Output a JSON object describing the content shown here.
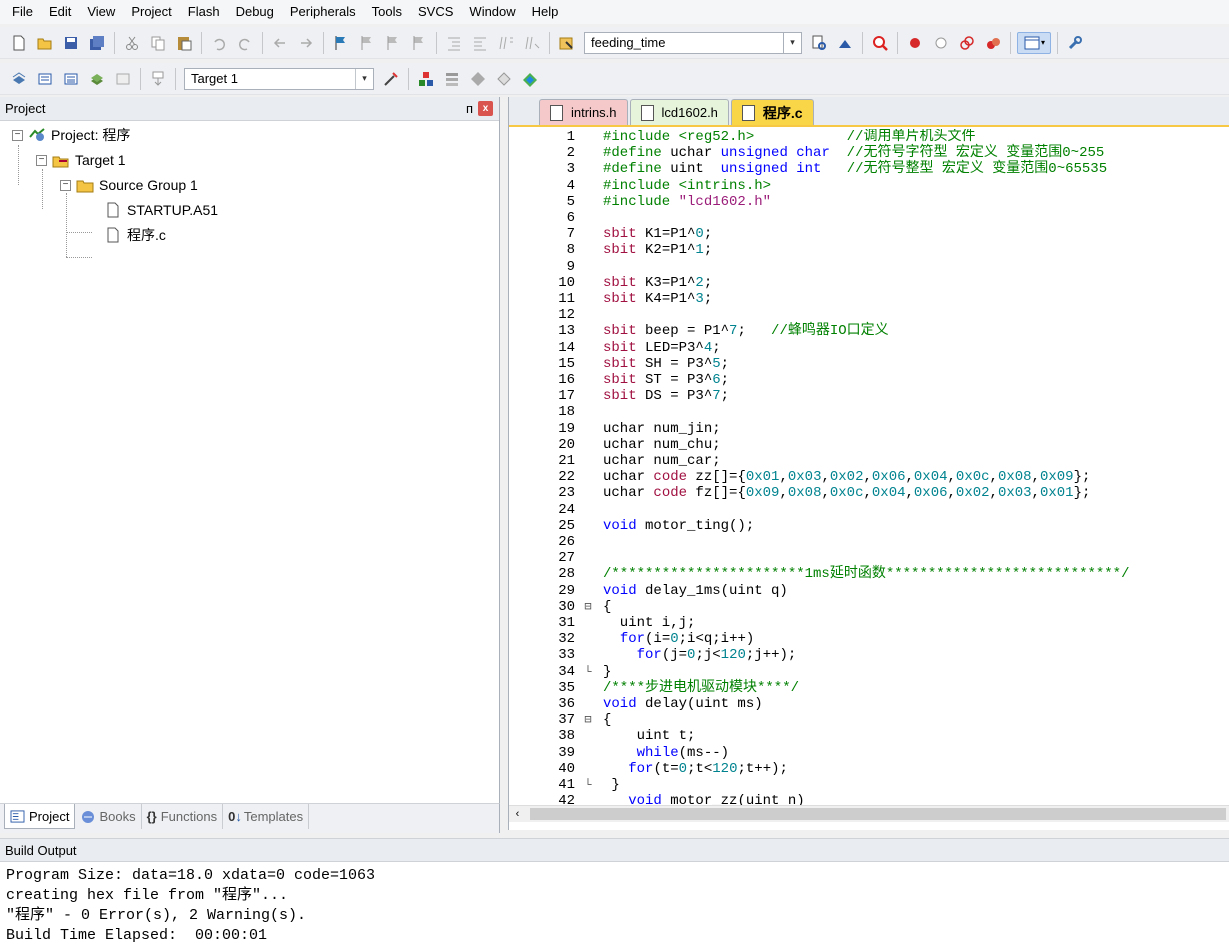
{
  "menu": [
    "File",
    "Edit",
    "View",
    "Project",
    "Flash",
    "Debug",
    "Peripherals",
    "Tools",
    "SVCS",
    "Window",
    "Help"
  ],
  "toolbar1": {
    "find_combo_value": "feeding_time"
  },
  "toolbar2": {
    "target_combo_value": "Target 1"
  },
  "project_panel": {
    "title": "Project",
    "pin_glyph": "ᴨ",
    "close_glyph": "x",
    "tree": [
      {
        "label": "Project: 程序",
        "icon": "project-icon",
        "toggle": "−"
      },
      {
        "label": "Target 1",
        "icon": "target-icon",
        "toggle": "−"
      },
      {
        "label": "Source Group 1",
        "icon": "folder-icon",
        "toggle": "−"
      },
      {
        "label": "STARTUP.A51",
        "icon": "file-icon"
      },
      {
        "label": "程序.c",
        "icon": "file-icon"
      }
    ],
    "tabs": [
      "Project",
      "Books",
      "Functions",
      "Templates"
    ]
  },
  "editor": {
    "tabs": [
      {
        "label": "intrins.h"
      },
      {
        "label": "lcd1602.h"
      },
      {
        "label": "程序.c",
        "active": true
      }
    ],
    "lines": [
      {
        "n": "1",
        "f": "",
        "segs": [
          [
            "pp",
            "#include <reg52.h>"
          ],
          [
            "t",
            "           "
          ],
          [
            "cm",
            "//调用单片机头文件"
          ]
        ]
      },
      {
        "n": "2",
        "f": "",
        "segs": [
          [
            "pp",
            "#define "
          ],
          [
            "t",
            "uchar "
          ],
          [
            "kw",
            "unsigned char"
          ],
          [
            "t",
            "  "
          ],
          [
            "cm",
            "//无符号字符型 宏定义 变量范围0~255"
          ]
        ]
      },
      {
        "n": "3",
        "f": "",
        "segs": [
          [
            "pp",
            "#define "
          ],
          [
            "t",
            "uint  "
          ],
          [
            "kw",
            "unsigned int"
          ],
          [
            "t",
            "   "
          ],
          [
            "cm",
            "//无符号整型 宏定义 变量范围0~65535"
          ]
        ]
      },
      {
        "n": "4",
        "f": "",
        "segs": [
          [
            "pp",
            "#include <intrins.h>"
          ]
        ]
      },
      {
        "n": "5",
        "f": "",
        "segs": [
          [
            "pp",
            "#include "
          ],
          [
            "str",
            "\"lcd1602.h\""
          ]
        ]
      },
      {
        "n": "6",
        "f": "",
        "segs": []
      },
      {
        "n": "7",
        "f": "",
        "segs": [
          [
            "ty",
            "sbit"
          ],
          [
            "t",
            " K1=P1^"
          ],
          [
            "num",
            "0"
          ],
          [
            "t",
            ";"
          ]
        ]
      },
      {
        "n": "8",
        "f": "",
        "segs": [
          [
            "ty",
            "sbit"
          ],
          [
            "t",
            " K2=P1^"
          ],
          [
            "num",
            "1"
          ],
          [
            "t",
            ";"
          ]
        ]
      },
      {
        "n": "9",
        "f": "",
        "segs": []
      },
      {
        "n": "10",
        "f": "",
        "segs": [
          [
            "ty",
            "sbit"
          ],
          [
            "t",
            " K3=P1^"
          ],
          [
            "num",
            "2"
          ],
          [
            "t",
            ";"
          ]
        ]
      },
      {
        "n": "11",
        "f": "",
        "segs": [
          [
            "ty",
            "sbit"
          ],
          [
            "t",
            " K4=P1^"
          ],
          [
            "num",
            "3"
          ],
          [
            "t",
            ";"
          ]
        ]
      },
      {
        "n": "12",
        "f": "",
        "segs": []
      },
      {
        "n": "13",
        "f": "",
        "segs": [
          [
            "ty",
            "sbit"
          ],
          [
            "t",
            " beep = P1^"
          ],
          [
            "num",
            "7"
          ],
          [
            "t",
            ";   "
          ],
          [
            "cm",
            "//蜂鸣器IO口定义"
          ]
        ]
      },
      {
        "n": "14",
        "f": "",
        "segs": [
          [
            "ty",
            "sbit"
          ],
          [
            "t",
            " LED=P3^"
          ],
          [
            "num",
            "4"
          ],
          [
            "t",
            ";"
          ]
        ]
      },
      {
        "n": "15",
        "f": "",
        "segs": [
          [
            "ty",
            "sbit"
          ],
          [
            "t",
            " SH = P3^"
          ],
          [
            "num",
            "5"
          ],
          [
            "t",
            ";"
          ]
        ]
      },
      {
        "n": "16",
        "f": "",
        "segs": [
          [
            "ty",
            "sbit"
          ],
          [
            "t",
            " ST = P3^"
          ],
          [
            "num",
            "6"
          ],
          [
            "t",
            ";"
          ]
        ]
      },
      {
        "n": "17",
        "f": "",
        "segs": [
          [
            "ty",
            "sbit"
          ],
          [
            "t",
            " DS = P3^"
          ],
          [
            "num",
            "7"
          ],
          [
            "t",
            ";"
          ]
        ]
      },
      {
        "n": "18",
        "f": "",
        "segs": []
      },
      {
        "n": "19",
        "f": "",
        "segs": [
          [
            "t",
            "uchar num_jin;"
          ]
        ]
      },
      {
        "n": "20",
        "f": "",
        "segs": [
          [
            "t",
            "uchar num_chu;"
          ]
        ]
      },
      {
        "n": "21",
        "f": "",
        "segs": [
          [
            "t",
            "uchar num_car;"
          ]
        ]
      },
      {
        "n": "22",
        "f": "",
        "segs": [
          [
            "t",
            "uchar "
          ],
          [
            "ty",
            "code"
          ],
          [
            "t",
            " zz[]={"
          ],
          [
            "num",
            "0x01"
          ],
          [
            "t",
            ","
          ],
          [
            "num",
            "0x03"
          ],
          [
            "t",
            ","
          ],
          [
            "num",
            "0x02"
          ],
          [
            "t",
            ","
          ],
          [
            "num",
            "0x06"
          ],
          [
            "t",
            ","
          ],
          [
            "num",
            "0x04"
          ],
          [
            "t",
            ","
          ],
          [
            "num",
            "0x0c"
          ],
          [
            "t",
            ","
          ],
          [
            "num",
            "0x08"
          ],
          [
            "t",
            ","
          ],
          [
            "num",
            "0x09"
          ],
          [
            "t",
            "};"
          ]
        ]
      },
      {
        "n": "23",
        "f": "",
        "segs": [
          [
            "t",
            "uchar "
          ],
          [
            "ty",
            "code"
          ],
          [
            "t",
            " fz[]={"
          ],
          [
            "num",
            "0x09"
          ],
          [
            "t",
            ","
          ],
          [
            "num",
            "0x08"
          ],
          [
            "t",
            ","
          ],
          [
            "num",
            "0x0c"
          ],
          [
            "t",
            ","
          ],
          [
            "num",
            "0x04"
          ],
          [
            "t",
            ","
          ],
          [
            "num",
            "0x06"
          ],
          [
            "t",
            ","
          ],
          [
            "num",
            "0x02"
          ],
          [
            "t",
            ","
          ],
          [
            "num",
            "0x03"
          ],
          [
            "t",
            ","
          ],
          [
            "num",
            "0x01"
          ],
          [
            "t",
            "};"
          ]
        ]
      },
      {
        "n": "24",
        "f": "",
        "segs": []
      },
      {
        "n": "25",
        "f": "",
        "segs": [
          [
            "kw",
            "void"
          ],
          [
            "t",
            " motor_ting();"
          ]
        ]
      },
      {
        "n": "26",
        "f": "",
        "segs": []
      },
      {
        "n": "27",
        "f": "",
        "segs": []
      },
      {
        "n": "28",
        "f": "",
        "segs": [
          [
            "cm",
            "/***********************1ms延时函数****************************/"
          ]
        ]
      },
      {
        "n": "29",
        "f": "",
        "segs": [
          [
            "kw",
            "void"
          ],
          [
            "t",
            " delay_1ms(uint q)"
          ]
        ]
      },
      {
        "n": "30",
        "f": "⊟",
        "segs": [
          [
            "t",
            "{"
          ]
        ]
      },
      {
        "n": "31",
        "f": "",
        "segs": [
          [
            "t",
            "  uint i,j;"
          ]
        ]
      },
      {
        "n": "32",
        "f": "",
        "segs": [
          [
            "t",
            "  "
          ],
          [
            "kw",
            "for"
          ],
          [
            "t",
            "(i="
          ],
          [
            "num",
            "0"
          ],
          [
            "t",
            ";i<q;i++)"
          ]
        ]
      },
      {
        "n": "33",
        "f": "",
        "segs": [
          [
            "t",
            "    "
          ],
          [
            "kw",
            "for"
          ],
          [
            "t",
            "(j="
          ],
          [
            "num",
            "0"
          ],
          [
            "t",
            ";j<"
          ],
          [
            "num",
            "120"
          ],
          [
            "t",
            ";j++);"
          ]
        ]
      },
      {
        "n": "34",
        "f": "└",
        "segs": [
          [
            "t",
            "}"
          ]
        ]
      },
      {
        "n": "35",
        "f": "",
        "segs": [
          [
            "cm",
            "/****步进电机驱动模块****/"
          ]
        ]
      },
      {
        "n": "36",
        "f": "",
        "segs": [
          [
            "kw",
            "void"
          ],
          [
            "t",
            " delay(uint ms)"
          ]
        ]
      },
      {
        "n": "37",
        "f": "⊟",
        "segs": [
          [
            "t",
            "{"
          ]
        ]
      },
      {
        "n": "38",
        "f": "",
        "segs": [
          [
            "t",
            "    uint t;"
          ]
        ]
      },
      {
        "n": "39",
        "f": "",
        "segs": [
          [
            "t",
            "    "
          ],
          [
            "kw",
            "while"
          ],
          [
            "t",
            "(ms--)"
          ]
        ]
      },
      {
        "n": "40",
        "f": "",
        "segs": [
          [
            "t",
            "   "
          ],
          [
            "kw",
            "for"
          ],
          [
            "t",
            "(t="
          ],
          [
            "num",
            "0"
          ],
          [
            "t",
            ";t<"
          ],
          [
            "num",
            "120"
          ],
          [
            "t",
            ";t++);"
          ]
        ]
      },
      {
        "n": "41",
        "f": "└",
        "segs": [
          [
            "t",
            " }"
          ]
        ]
      },
      {
        "n": "42",
        "f": "",
        "segs": [
          [
            "t",
            "   "
          ],
          [
            "kw",
            "void"
          ],
          [
            "t",
            " motor_zz(uint n)"
          ]
        ]
      }
    ]
  },
  "build_output": {
    "title": "Build Output",
    "lines": [
      "Program Size: data=18.0 xdata=0 code=1063",
      "creating hex file from \"程序\"...",
      "\"程序\" - 0 Error(s), 2 Warning(s).",
      "Build Time Elapsed:  00:00:01"
    ]
  }
}
